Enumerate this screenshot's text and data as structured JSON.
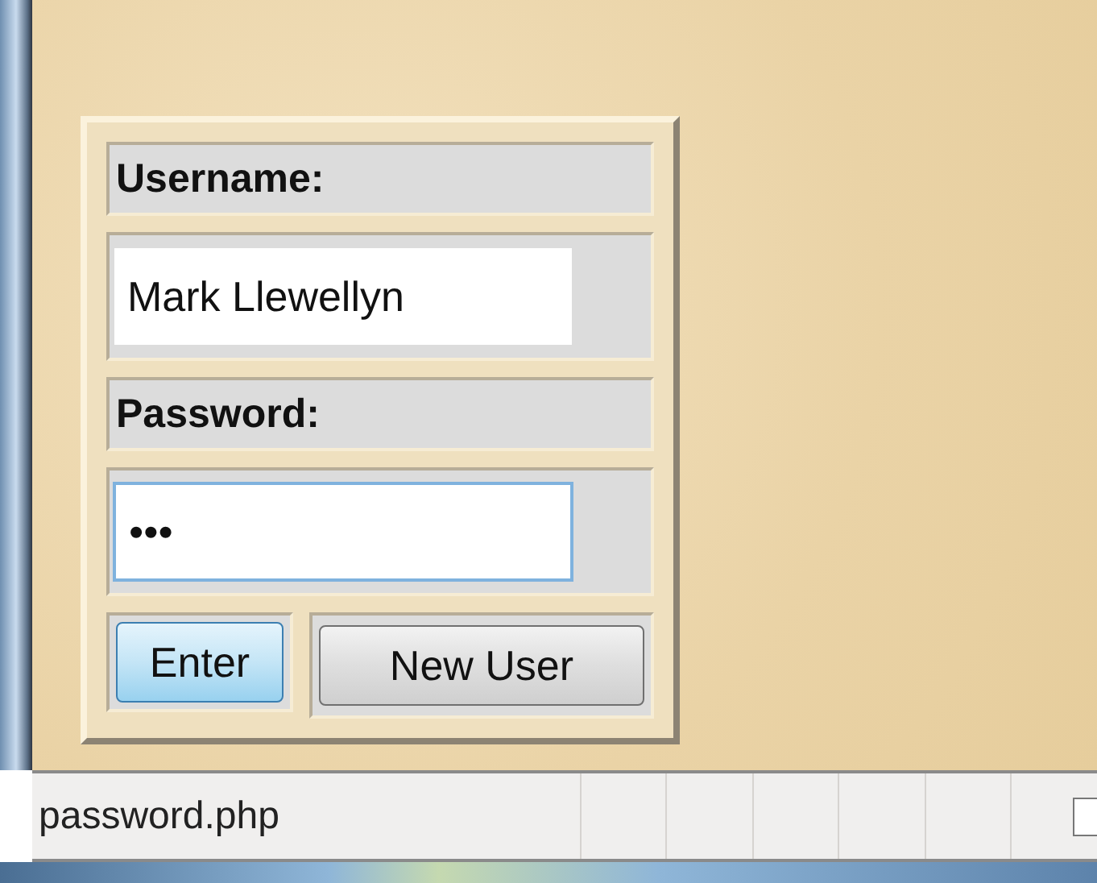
{
  "login_form": {
    "fields": [
      {
        "label": "Username:",
        "value": "Mark Llewellyn",
        "focused": false
      },
      {
        "label": "Password:",
        "value": "•••",
        "focused": true
      }
    ],
    "buttons": [
      {
        "label": "Enter",
        "default": true
      },
      {
        "label": "New User",
        "default": false
      }
    ]
  },
  "status_bar": {
    "text": "password.php"
  }
}
